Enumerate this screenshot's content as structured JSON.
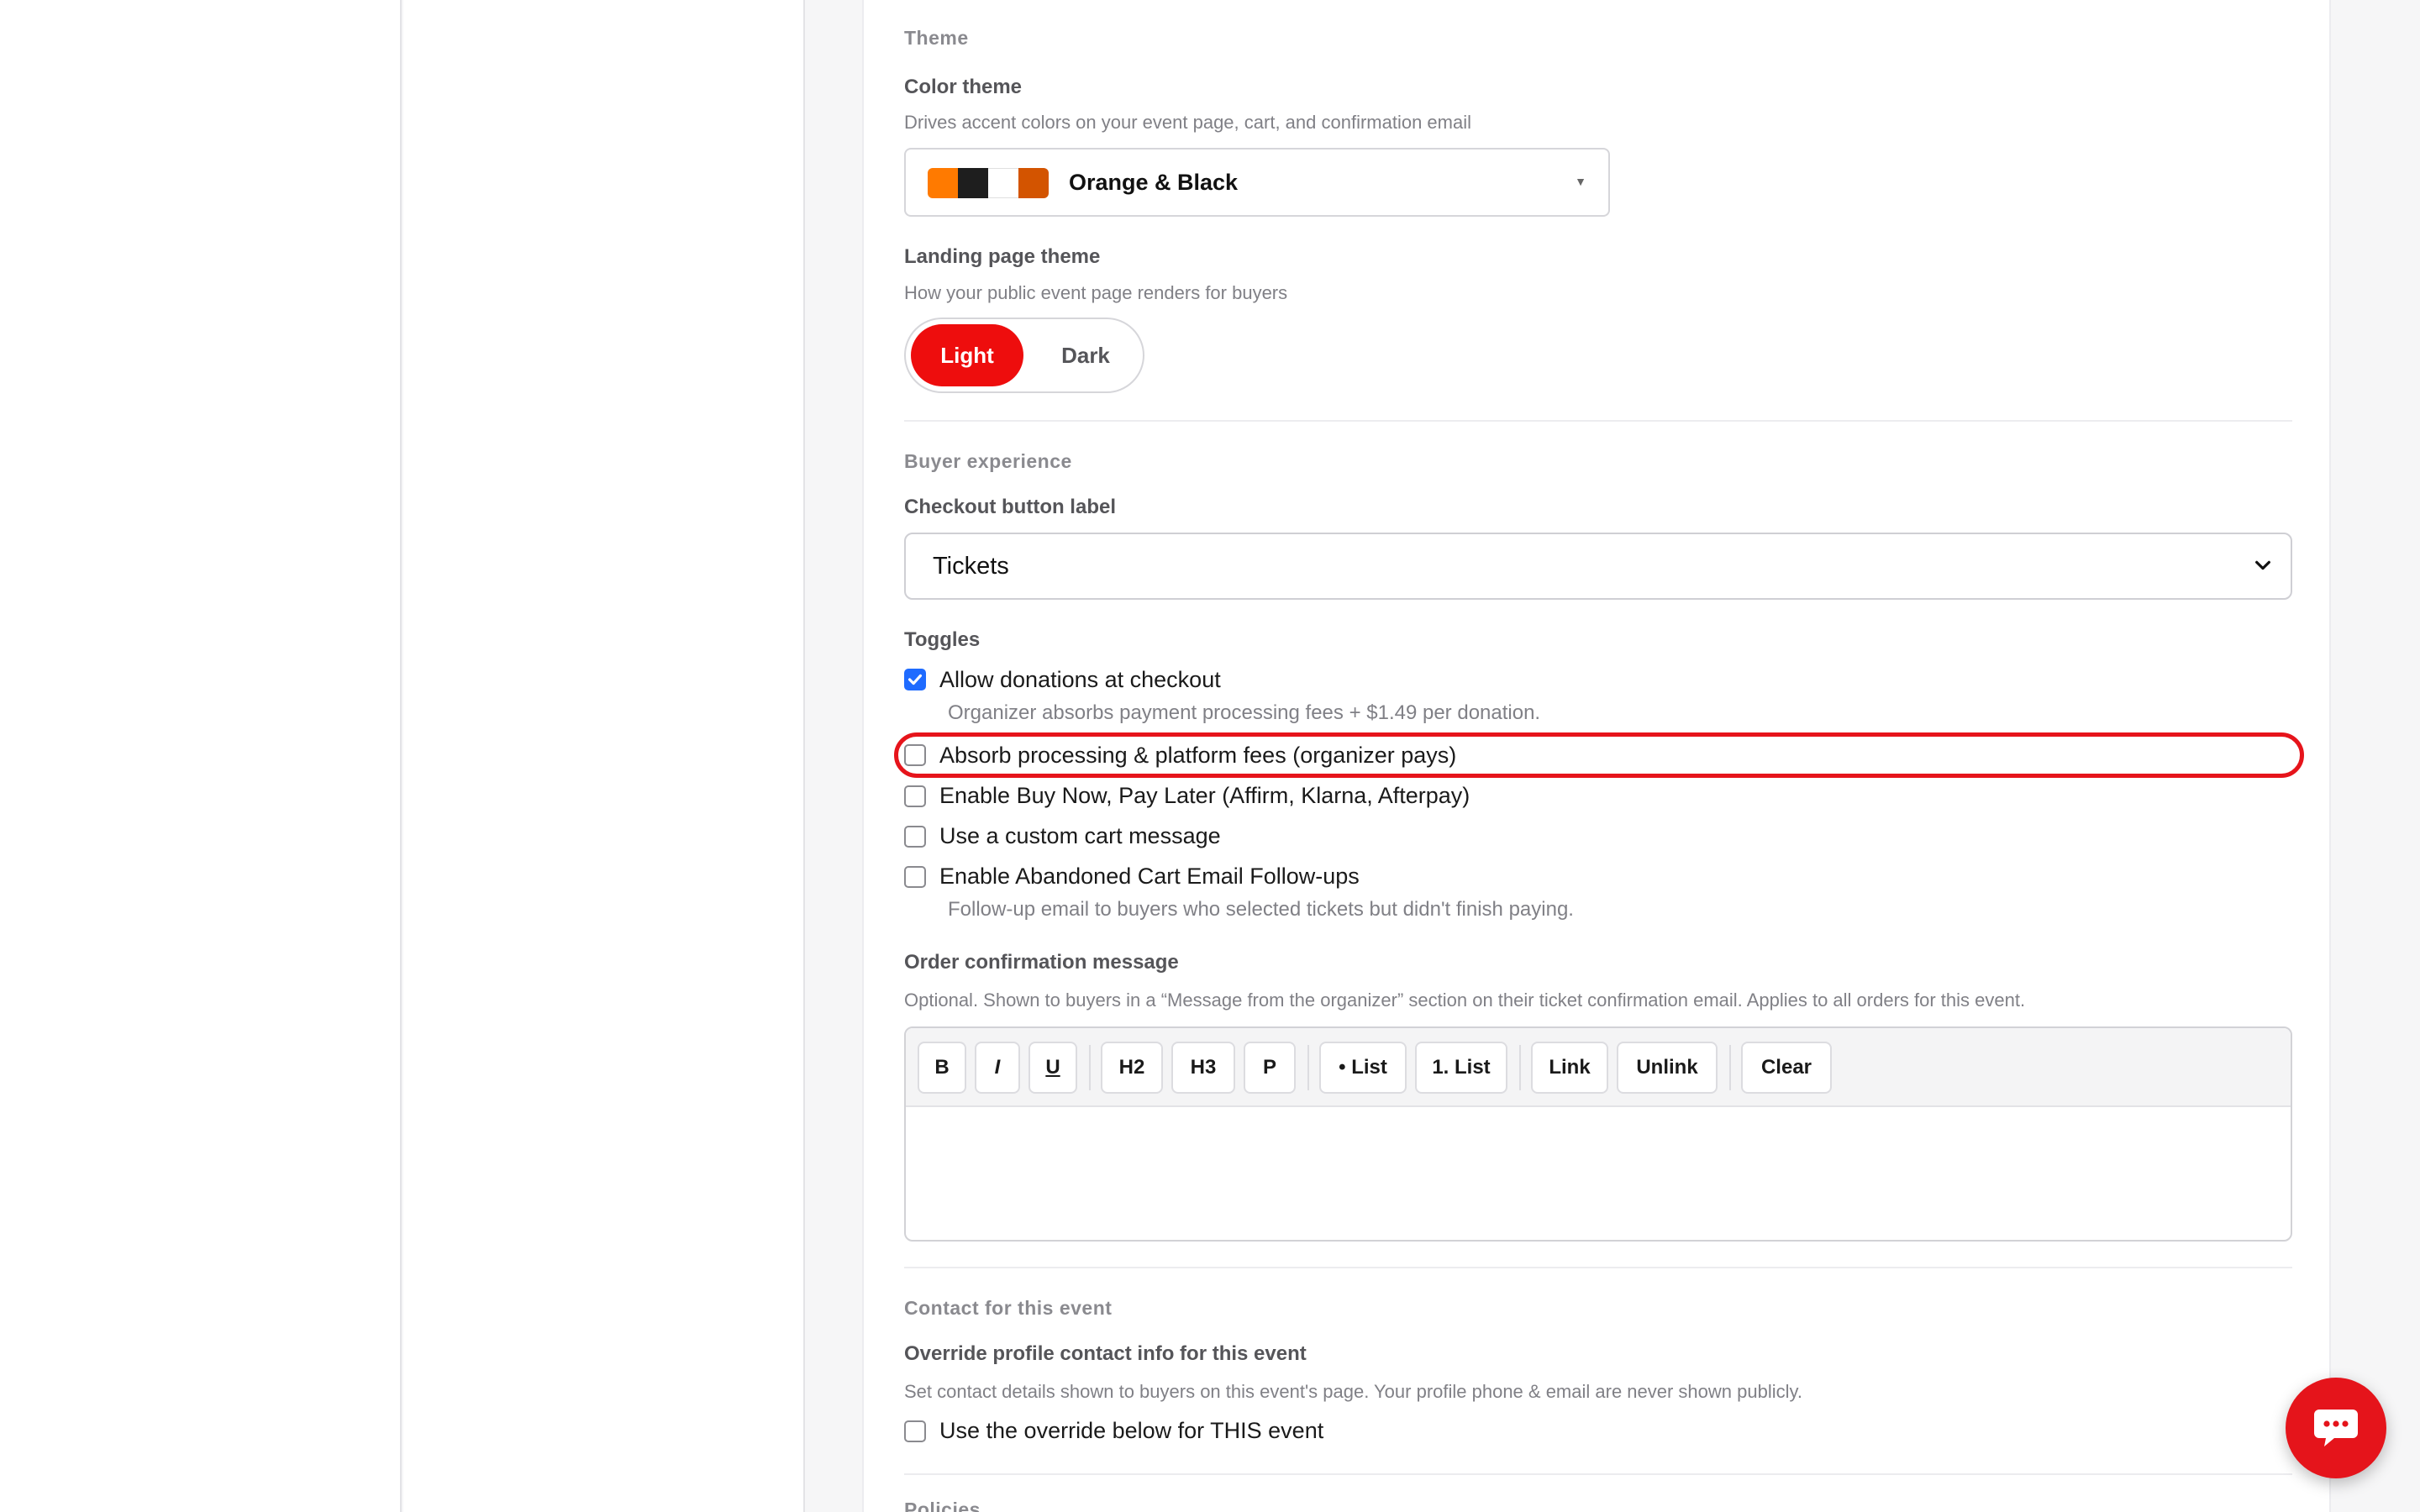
{
  "theme_section": {
    "heading": "Theme",
    "color_theme": {
      "label": "Color theme",
      "help": "Drives accent colors on your event page, cart, and confirmation email",
      "selected": "Orange & Black",
      "swatches": [
        "#ff7a00",
        "#1e1e1e",
        "#ffffff",
        "#d35400"
      ]
    },
    "landing_theme": {
      "label": "Landing page theme",
      "help": "How your public event page renders for buyers",
      "options": [
        "Light",
        "Dark"
      ],
      "selected": "Light"
    }
  },
  "buyer_section": {
    "heading": "Buyer experience",
    "checkout_label": {
      "label": "Checkout button label",
      "value": "Tickets"
    },
    "toggles_label": "Toggles",
    "toggles": [
      {
        "label": "Allow donations at checkout",
        "checked": true,
        "help": "Organizer absorbs payment processing fees + $1.49 per donation."
      },
      {
        "label": "Absorb processing & platform fees (organizer pays)",
        "checked": false,
        "help": ""
      },
      {
        "label": "Enable Buy Now, Pay Later (Affirm, Klarna, Afterpay)",
        "checked": false,
        "help": ""
      },
      {
        "label": "Use a custom cart message",
        "checked": false,
        "help": ""
      },
      {
        "label": "Enable Abandoned Cart Email Follow-ups",
        "checked": false,
        "help": "Follow-up email to buyers who selected tickets but didn't finish paying."
      }
    ],
    "order_confirmation": {
      "label": "Order confirmation message",
      "help": "Optional. Shown to buyers in a “Message from the organizer” section on their ticket confirmation email. Applies to all orders for this event.",
      "toolbar": [
        "B",
        "I",
        "U",
        "H2",
        "H3",
        "P",
        "• List",
        "1. List",
        "Link",
        "Unlink",
        "Clear"
      ]
    }
  },
  "contact_section": {
    "heading": "Contact for this event",
    "override_label": "Override profile contact info for this event",
    "override_help": "Set contact details shown to buyers on this event's page. Your profile phone & email are never shown publicly.",
    "override_checkbox": {
      "label": "Use the override below for THIS event",
      "checked": false
    }
  },
  "next_section": {
    "heading": "Policies"
  },
  "colors": {
    "accent": "#ee0d0d",
    "highlight": "#e6141b",
    "checkbox": "#1f6bff"
  },
  "icons": {
    "chat": "chat-bubble-icon",
    "select_caret": "chevron-down-icon"
  }
}
